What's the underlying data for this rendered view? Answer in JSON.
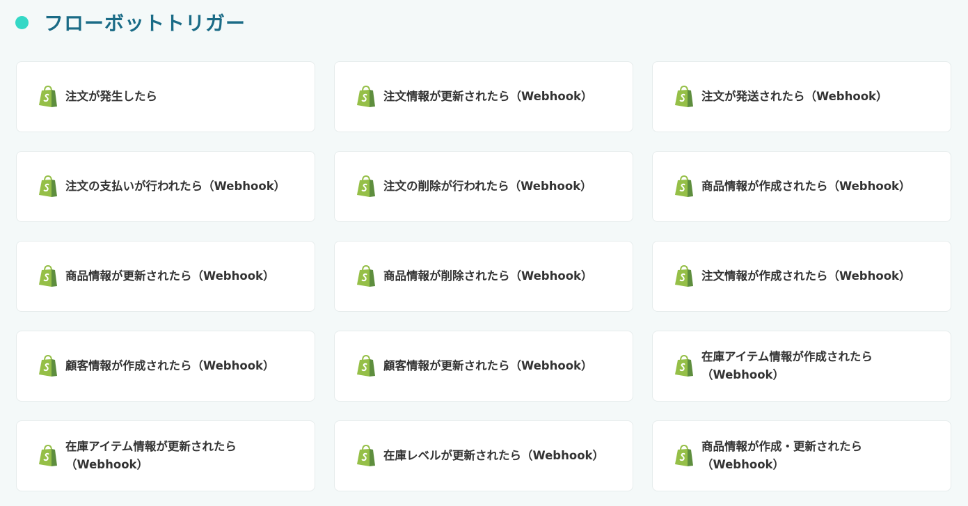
{
  "header": {
    "title": "フローボットトリガー"
  },
  "colors": {
    "accent_dot": "#34d8c6",
    "title": "#1a6b86",
    "shopify_green": "#95bf47",
    "shopify_dark_green": "#5e8e3e"
  },
  "triggers": [
    {
      "icon": "shopify-icon",
      "label": "注文が発生したら"
    },
    {
      "icon": "shopify-icon",
      "label": "注文情報が更新されたら（Webhook）"
    },
    {
      "icon": "shopify-icon",
      "label": "注文が発送されたら（Webhook）"
    },
    {
      "icon": "shopify-icon",
      "label": "注文の支払いが行われたら（Webhook）"
    },
    {
      "icon": "shopify-icon",
      "label": "注文の削除が行われたら（Webhook）"
    },
    {
      "icon": "shopify-icon",
      "label": "商品情報が作成されたら（Webhook）"
    },
    {
      "icon": "shopify-icon",
      "label": "商品情報が更新されたら（Webhook）"
    },
    {
      "icon": "shopify-icon",
      "label": "商品情報が削除されたら（Webhook）"
    },
    {
      "icon": "shopify-icon",
      "label": "注文情報が作成されたら（Webhook）"
    },
    {
      "icon": "shopify-icon",
      "label": "顧客情報が作成されたら（Webhook）"
    },
    {
      "icon": "shopify-icon",
      "label": "顧客情報が更新されたら（Webhook）"
    },
    {
      "icon": "shopify-icon",
      "label": "在庫アイテム情報が作成されたら（Webhook）"
    },
    {
      "icon": "shopify-icon",
      "label": "在庫アイテム情報が更新されたら（Webhook）"
    },
    {
      "icon": "shopify-icon",
      "label": "在庫レベルが更新されたら（Webhook）"
    },
    {
      "icon": "shopify-icon",
      "label": "商品情報が作成・更新されたら（Webhook）"
    }
  ]
}
